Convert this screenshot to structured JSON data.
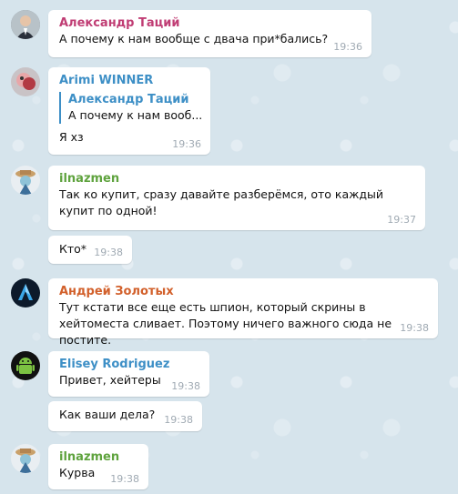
{
  "colors": {
    "alexandr": "#c03d74",
    "arimi": "#3d8fc6",
    "ilnazmen": "#5fa33e",
    "andrey": "#d2602b",
    "elisey": "#3d8fc6"
  },
  "messages": [
    {
      "sender": "Александр Таций",
      "text": "А почему к нам вообще с двача при*бались?",
      "time": "19:36",
      "avatar": "man-in-suit-avatar"
    },
    {
      "sender": "Arimi WINNER",
      "quote_sender": "Александр Таций",
      "quote_text": "А почему к нам вооб...",
      "text": "Я хз",
      "time": "19:36",
      "avatar": "pink-character-avatar"
    },
    {
      "sender": "ilnazmen",
      "text": "Так ко купит,  сразу давайте разберёмся, ото каждый купит по одной!",
      "time": "19:37",
      "avatar": "hat-character-avatar"
    },
    {
      "text": "Кто*",
      "time": "19:38"
    },
    {
      "sender": "Андрей Золотых",
      "text": "Тут кстати все еще есть шпион, который скрины в хейтоместа сливает. Поэтому ничего важного сюда не постите.",
      "time": "19:38",
      "avatar": "blue-logo-avatar"
    },
    {
      "sender": "Elisey Rodriguez",
      "text": "Привет, хейтеры",
      "time": "19:38",
      "avatar": "android-avatar"
    },
    {
      "text": "Как ваши дела?",
      "time": "19:38"
    },
    {
      "sender": "ilnazmen",
      "text": "Курва",
      "time": "19:38",
      "avatar": "hat-character-avatar"
    }
  ]
}
